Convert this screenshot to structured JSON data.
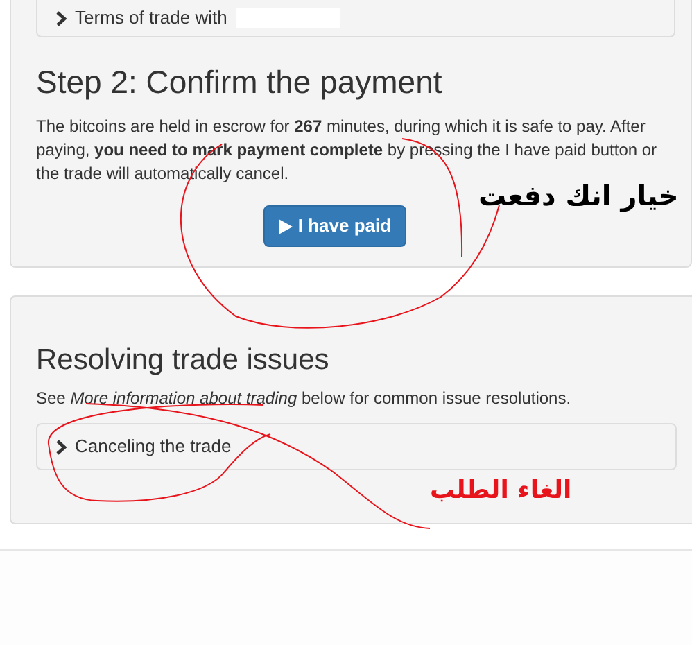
{
  "step_panel": {
    "terms_toggle": {
      "label": "Terms of trade with",
      "expanded": false
    },
    "heading": "Step 2: Confirm the payment",
    "description": "The bitcoins are held in escrow for **267** minutes, during which it is safe to pay. After paying, **you need to mark payment complete** by pressing the I have paid button or the trade will automatically cancel.",
    "button": "I have paid"
  },
  "issues_panel": {
    "heading": "Resolving trade issues",
    "description": "See *More information about trading* below for common issue resolutions.",
    "cancel_toggle": {
      "label": "Canceling the trade",
      "expanded": false
    }
  },
  "annotations": [
    {
      "text": "خيار انك دفعت",
      "color": "#000000"
    },
    {
      "text": "الغاء الطلب",
      "color": "#e8141c"
    }
  ]
}
